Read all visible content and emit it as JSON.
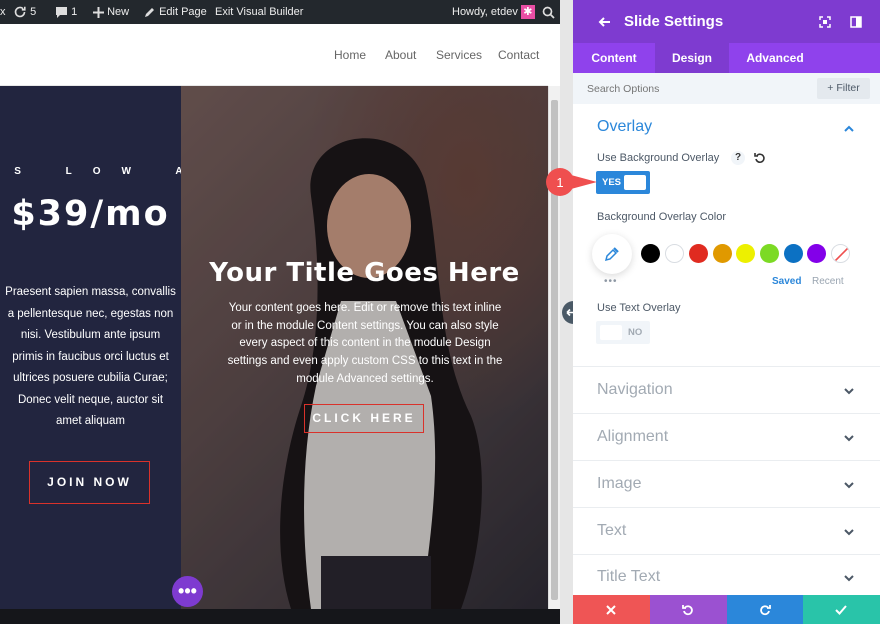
{
  "admin_bar": {
    "count_updates": "5",
    "count_comments": "1",
    "new_label": "New",
    "edit_page_label": "Edit Page",
    "exit_label": "Exit Visual Builder",
    "greeting": "Howdy, etdev"
  },
  "site_nav": [
    "Home",
    "About",
    "Services",
    "Contact"
  ],
  "hero_left": {
    "eyebrow": "AS LOW AS",
    "price": "$39/mo",
    "body": "Praesent sapien massa, convallis a pellentesque nec, egestas non nisi. Vestibulum ante ipsum primis in faucibus orci luctus et ultrices posuere cubilia Curae; Donec velit neque, auctor sit amet aliquam",
    "button": "JOIN NOW"
  },
  "slide": {
    "title": "Your Title Goes Here",
    "content": "Your content goes here. Edit or remove this text inline or in the module Content settings. You can also style every aspect of this content in the module Design settings and even apply custom CSS to this text in the module Advanced settings.",
    "button": "CLICK HERE"
  },
  "panel": {
    "title": "Slide Settings",
    "tabs": [
      "Content",
      "Design",
      "Advanced"
    ],
    "active_tab": "Design",
    "search_placeholder": "Search Options",
    "filter_label": "Filter",
    "overlay": {
      "title": "Overlay",
      "use_bg_overlay_label": "Use Background Overlay",
      "use_bg_overlay_value": "YES",
      "callout_number": "1",
      "bg_overlay_color_label": "Background Overlay Color",
      "saved_label": "Saved",
      "recent_label": "Recent",
      "use_text_overlay_label": "Use Text Overlay",
      "use_text_overlay_value": "NO"
    },
    "collapsed_sections": [
      "Navigation",
      "Alignment",
      "Image",
      "Text",
      "Title Text"
    ]
  },
  "colors": {
    "accent_purple": "#8f42ec",
    "panel_header": "#7e3bd0",
    "toggle_blue": "#2b87da",
    "callout_red": "#ef4f4f",
    "swatches": [
      "#000000",
      "#ffffff",
      "#e02b20",
      "#e09900",
      "#edf000",
      "#7cda24",
      "#0c71c3",
      "#8300e9",
      "none"
    ],
    "action_cancel": "#ef5555",
    "action_undo": "#9b51d1",
    "action_redo": "#2b87da",
    "action_save": "#29c4a9"
  },
  "icons": {
    "action_bar": [
      "close-icon",
      "undo-icon",
      "redo-icon",
      "check-icon"
    ],
    "header": [
      "back-arrow-icon",
      "fullscreen-icon",
      "sidebar-toggle-icon"
    ]
  }
}
